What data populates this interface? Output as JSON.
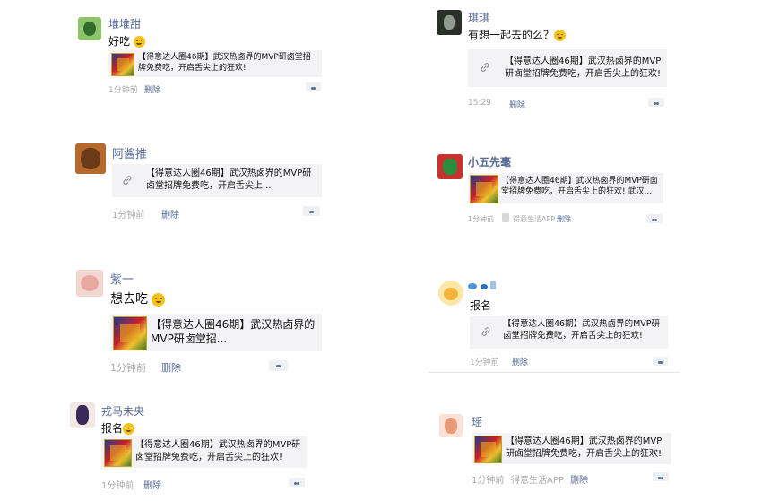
{
  "posts": [
    {
      "name": "堆堆甜",
      "text": "好吃",
      "card_title": "【得意达人圈46期】武汉热卤界的MVP研卤堂招牌免费吃，开启舌尖上的狂欢!",
      "time": "1分钟前",
      "delete": "删除"
    },
    {
      "name": "阿酱推",
      "card_title": "【得意达人圈46期】武汉热卤界的MVP研卤堂招牌免费吃，开启舌尖上...",
      "time": "1分钟前",
      "delete": "删除"
    },
    {
      "name": "紫一",
      "text": "想去吃",
      "card_title": "【得意达人圈46期】武汉热卤界的MVP研卤堂招...",
      "time": "1分钟前",
      "delete": "删除"
    },
    {
      "name": "戎马未央",
      "text": "报名",
      "card_title": "【得意达人圈46期】武汉热卤界的MVP研卤堂招牌免费吃，开启舌尖上的狂欢!",
      "time": "1分钟前",
      "delete": "删除"
    },
    {
      "name": "琪琪",
      "text": "有想一起去的么？",
      "card_title": "【得意达人圈46期】武汉热卤界的MVP研卤堂招牌免费吃，开启舌尖上的狂欢!",
      "time": "15:29",
      "delete": "删除"
    },
    {
      "name": "小五先毫",
      "card_title": "【得意达人圈46期】武汉热卤界的MVP研卤堂招牌免费吃，开启舌尖上的狂欢! 武汉...",
      "time": "1分钟前",
      "source": "得意生活APP",
      "delete": "删除"
    },
    {
      "name": "",
      "text": "报名",
      "card_title": "【得意达人圈46期】武汉热卤界的MVP研卤堂招牌免费吃，开启舌尖上的狂欢!",
      "time": "1分钟前",
      "delete": "删除"
    },
    {
      "name": "瑶",
      "card_title": "【得意达人圈46期】武汉热卤界的MVP研卤堂招牌免费吃，开启舌尖上的狂欢!",
      "time": "1分钟前",
      "source": "得意生活APP",
      "delete": "删除"
    }
  ],
  "colors": {
    "name": "#576b95",
    "meta": "#a8a8a8",
    "card_bg": "#f3f3f5"
  }
}
